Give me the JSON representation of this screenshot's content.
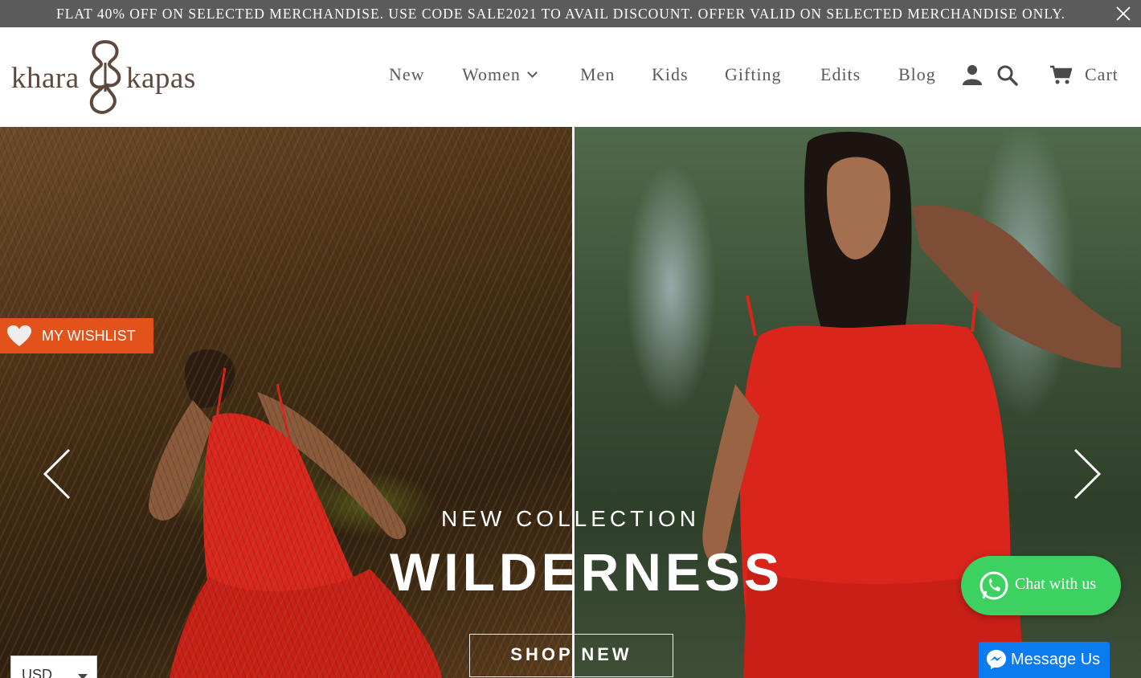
{
  "announcement": {
    "text": "FLAT 40% OFF ON SELECTED MERCHANDISE. USE CODE SALE2021 TO AVAIL DISCOUNT. OFFER VALID ON SELECTED MERCHANDISE ONLY."
  },
  "brand": {
    "word1": "khara",
    "word2": "kapas"
  },
  "nav": {
    "items": [
      {
        "label": "New"
      },
      {
        "label": "Women",
        "has_dropdown": true
      },
      {
        "label": "Men"
      },
      {
        "label": "Kids"
      },
      {
        "label": "Gifting"
      },
      {
        "label": "Edits"
      },
      {
        "label": "Blog"
      }
    ],
    "icons": [
      "account-icon",
      "search-icon",
      "cart-icon"
    ],
    "cart_label": "Cart"
  },
  "hero": {
    "subtitle": "NEW COLLECTION",
    "title": "WILDERNESS",
    "cta": "SHOP NEW"
  },
  "wishlist": {
    "label": "MY WISHLIST",
    "color": "#e2531b"
  },
  "chat": {
    "label": "Chat with us",
    "color": "#3dd162"
  },
  "messenger": {
    "label": "Message Us",
    "color": "#0b7bf0"
  },
  "currency": {
    "selected": "USD"
  },
  "colors": {
    "announcement_bg": "#5b5b5b",
    "brand_brown": "#5d4a3d",
    "dress_red": "#d9251c"
  }
}
